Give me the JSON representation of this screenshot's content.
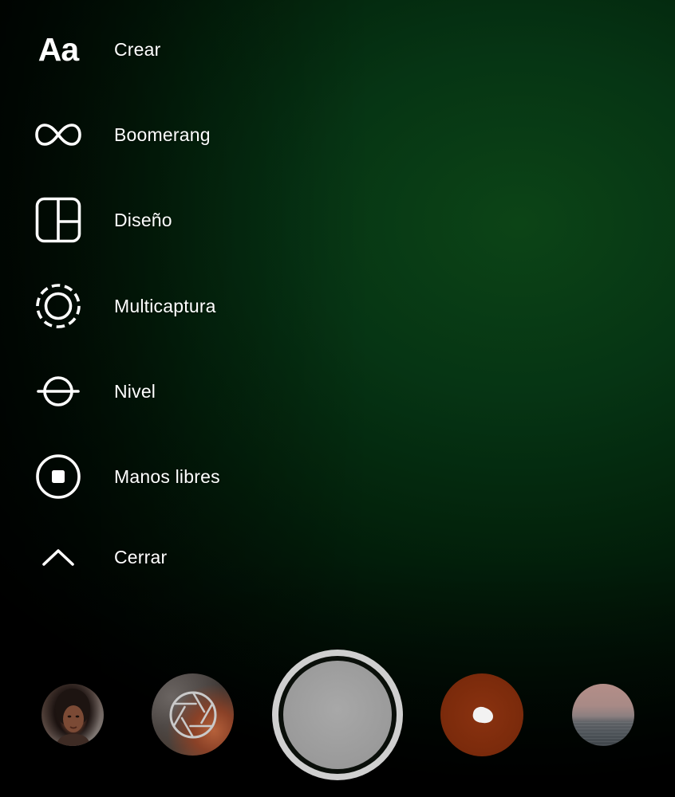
{
  "menu": {
    "items": [
      {
        "label": "Crear",
        "icon": "text-create-icon",
        "glyph": "Aa"
      },
      {
        "label": "Boomerang",
        "icon": "infinity-icon"
      },
      {
        "label": "Diseño",
        "icon": "layout-grid-icon"
      },
      {
        "label": "Multicaptura",
        "icon": "multicapture-icon"
      },
      {
        "label": "Nivel",
        "icon": "level-icon"
      },
      {
        "label": "Manos libres",
        "icon": "hands-free-icon"
      },
      {
        "label": "Cerrar",
        "icon": "chevron-up-icon"
      }
    ]
  },
  "bottom_bar": {
    "items": [
      {
        "name": "effect-portrait-thumbnail",
        "icon": "portrait-thumbnail"
      },
      {
        "name": "effect-aperture-thumbnail",
        "icon": "aperture-icon"
      },
      {
        "name": "shutter-button",
        "icon": "shutter-icon"
      },
      {
        "name": "effect-red-thumbnail",
        "icon": "blob-icon"
      },
      {
        "name": "effect-sunset-thumbnail",
        "icon": "sunset-thumbnail"
      }
    ]
  },
  "colors": {
    "background_accent": "#063514",
    "text": "#ffffff",
    "shutter": "#9a9a9a",
    "red_effect": "#7a2a0b"
  }
}
